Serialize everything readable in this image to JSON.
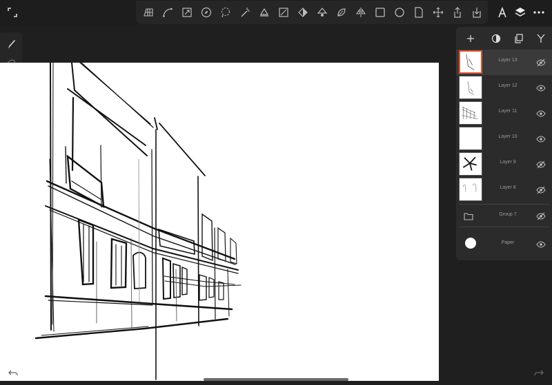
{
  "toolbar": {
    "tools": [
      "perspective-grid-icon",
      "curve-icon",
      "transform-icon",
      "compass-icon",
      "lasso-select-icon",
      "magic-wand-icon",
      "fill-bucket-icon",
      "ruler-icon",
      "symmetry-icon",
      "shape-diamond-icon",
      "leaf-brush-icon",
      "mirror-icon",
      "rectangle-icon",
      "ellipse-icon",
      "document-icon",
      "move-icon",
      "share-icon",
      "import-icon"
    ],
    "right": [
      "pen-tool-icon",
      "layers-icon",
      "more-icon"
    ]
  },
  "sidebar": {
    "tools": [
      "brush-icon",
      "smudge-icon",
      "eraser-icon",
      "outline-circle-icon",
      "color-swatch-icon",
      "opacity-dot-icon"
    ]
  },
  "layers_panel": {
    "header_icons": [
      "add-layer-icon",
      "blend-mode-icon",
      "duplicate-icon",
      "merge-icon"
    ],
    "layers": [
      {
        "name": "Layer 13",
        "visible": false,
        "selected": true
      },
      {
        "name": "Layer 12",
        "visible": true,
        "selected": false
      },
      {
        "name": "Layer 11",
        "visible": true,
        "selected": false
      },
      {
        "name": "Layer 10",
        "visible": true,
        "selected": false
      },
      {
        "name": "Layer 9",
        "visible": false,
        "selected": false
      },
      {
        "name": "Layer 8",
        "visible": false,
        "selected": false
      }
    ],
    "group": {
      "name": "Group 7",
      "visible": false
    },
    "paper": {
      "name": "Paper",
      "visible": true
    }
  },
  "colors": {
    "accent": "#e0562c",
    "canvas": "#ffffff",
    "chrome": "#1f1f1f"
  }
}
